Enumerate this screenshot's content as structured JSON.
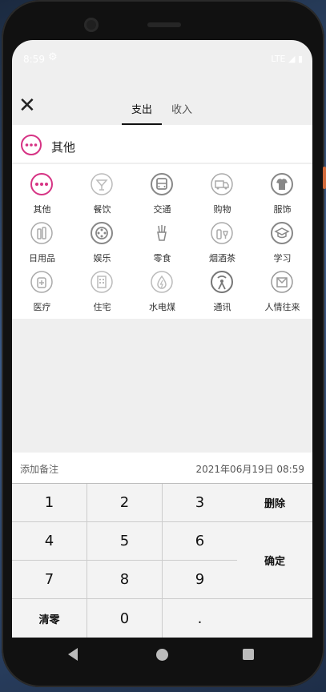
{
  "status": {
    "time": "8:59",
    "gear": "⚙",
    "right": "LTE ◢ ▮"
  },
  "header": {
    "close": "✕",
    "tabs": [
      {
        "label": "支出",
        "active": true
      },
      {
        "label": "收入",
        "active": false
      }
    ]
  },
  "selected": {
    "label": "其他",
    "color": "#d63384"
  },
  "categories": [
    {
      "label": "其他",
      "icon": "more-dots-icon"
    },
    {
      "label": "餐饮",
      "icon": "cocktail-icon"
    },
    {
      "label": "交通",
      "icon": "bus-icon"
    },
    {
      "label": "购物",
      "icon": "truck-icon"
    },
    {
      "label": "服饰",
      "icon": "shirt-icon"
    },
    {
      "label": "日用品",
      "icon": "toiletries-icon"
    },
    {
      "label": "娱乐",
      "icon": "film-reel-icon"
    },
    {
      "label": "零食",
      "icon": "fries-icon"
    },
    {
      "label": "烟酒茶",
      "icon": "wine-icon"
    },
    {
      "label": "学习",
      "icon": "graduation-cap-icon"
    },
    {
      "label": "医疗",
      "icon": "medicine-icon"
    },
    {
      "label": "住宅",
      "icon": "building-icon"
    },
    {
      "label": "水电煤",
      "icon": "water-electric-icon"
    },
    {
      "label": "通讯",
      "icon": "antenna-icon"
    },
    {
      "label": "人情往来",
      "icon": "envelope-icon"
    }
  ],
  "note": {
    "placeholder": "添加备注",
    "date": "2021年06月19日 08:59"
  },
  "keypad": {
    "k1": "1",
    "k2": "2",
    "k3": "3",
    "delete": "删除",
    "k4": "4",
    "k5": "5",
    "k6": "6",
    "k7": "7",
    "k8": "8",
    "k9": "9",
    "confirm": "确定",
    "clear": "清零",
    "k0": "0",
    "dot": "."
  }
}
